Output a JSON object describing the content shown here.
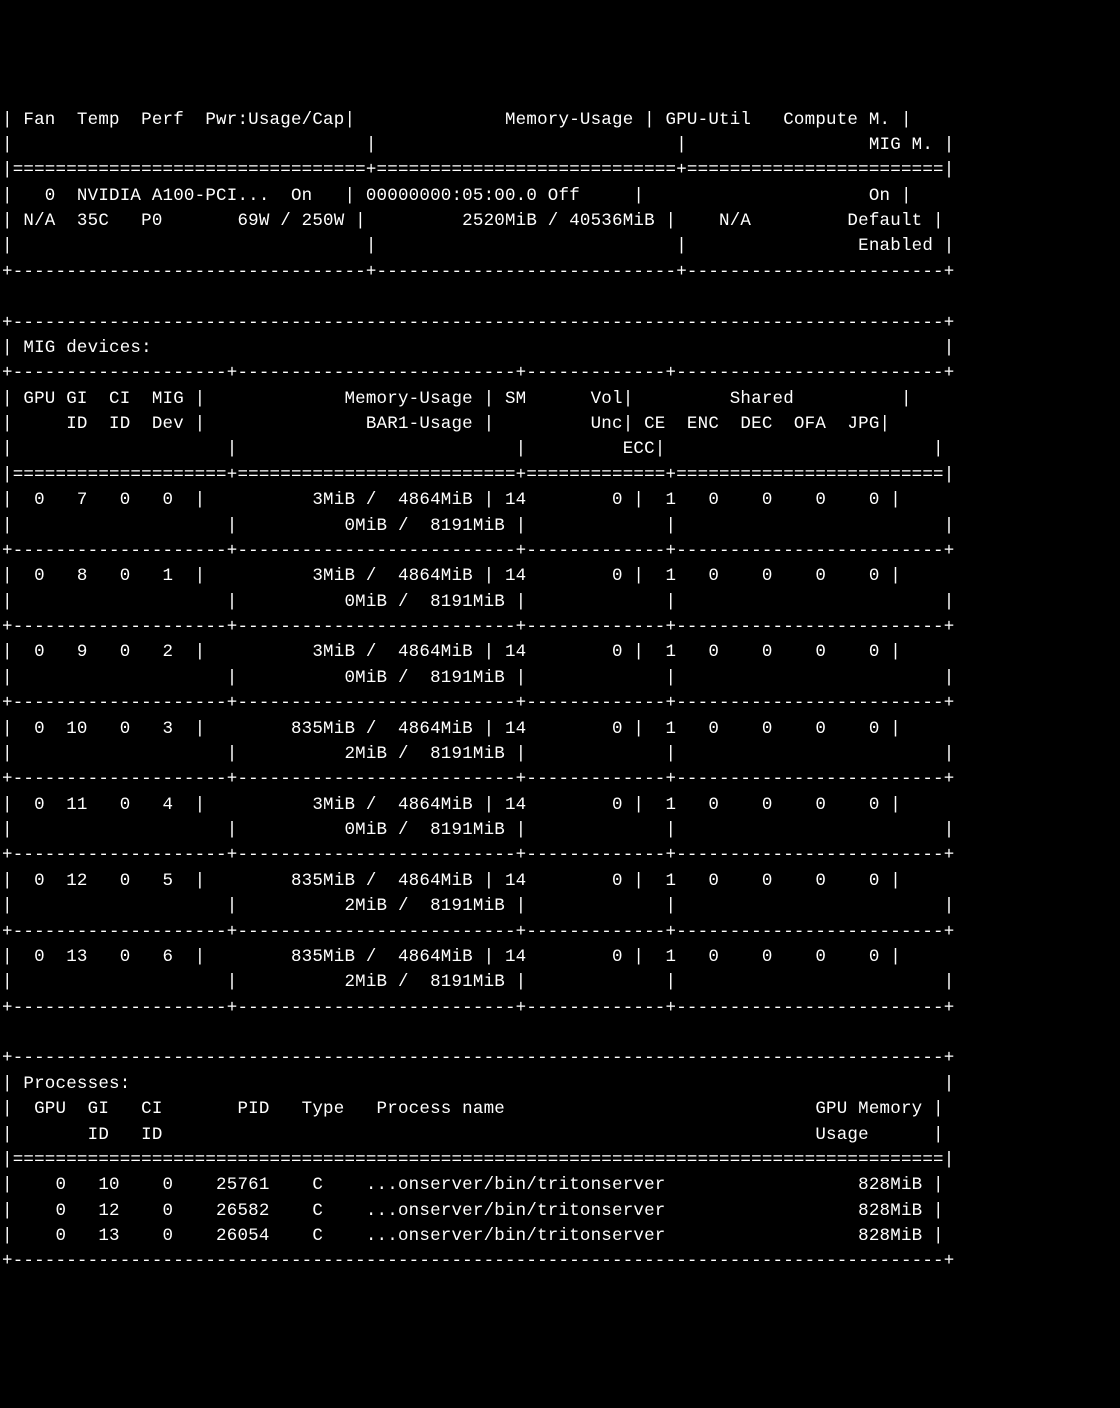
{
  "header": {
    "labels": {
      "fan": "Fan",
      "temp": "Temp",
      "perf": "Perf",
      "pwr": "Pwr:Usage/Cap",
      "mem": "Memory-Usage",
      "gpuutil": "GPU-Util",
      "compute": "Compute M.",
      "migm": "MIG M."
    }
  },
  "gpu": {
    "index": "0",
    "name": "NVIDIA A100-PCI...",
    "persistence": "On",
    "busid": "00000000:05:00.0",
    "disp_active": "Off",
    "ecc": "On",
    "fan": "N/A",
    "temp": "35C",
    "perf": "P0",
    "pwr_usage": "69W",
    "pwr_cap": "250W",
    "mem_used": "2520MiB",
    "mem_total": "40536MiB",
    "gpu_util": "N/A",
    "compute_mode": "Default",
    "mig_mode": "Enabled"
  },
  "mig": {
    "title": "MIG devices:",
    "header": {
      "gpu": "GPU",
      "gi": "GI",
      "ci": "CI",
      "migdev": "MIG",
      "id": "ID",
      "dev": "Dev",
      "mem": "Memory-Usage",
      "bar1": "BAR1-Usage",
      "sm": "SM",
      "vol": "Vol",
      "unc": "Unc",
      "ecc": "ECC",
      "shared": "Shared",
      "ce": "CE",
      "enc": "ENC",
      "dec": "DEC",
      "ofa": "OFA",
      "jpg": "JPG"
    },
    "devices": [
      {
        "gpu": "0",
        "gi": "7",
        "ci": "0",
        "dev": "0",
        "mem_used": "3MiB",
        "mem_total": "4864MiB",
        "bar1_used": "0MiB",
        "bar1_total": "8191MiB",
        "sm": "14",
        "ecc": "0",
        "ce": "1",
        "enc": "0",
        "dec": "0",
        "ofa": "0",
        "jpg": "0"
      },
      {
        "gpu": "0",
        "gi": "8",
        "ci": "0",
        "dev": "1",
        "mem_used": "3MiB",
        "mem_total": "4864MiB",
        "bar1_used": "0MiB",
        "bar1_total": "8191MiB",
        "sm": "14",
        "ecc": "0",
        "ce": "1",
        "enc": "0",
        "dec": "0",
        "ofa": "0",
        "jpg": "0"
      },
      {
        "gpu": "0",
        "gi": "9",
        "ci": "0",
        "dev": "2",
        "mem_used": "3MiB",
        "mem_total": "4864MiB",
        "bar1_used": "0MiB",
        "bar1_total": "8191MiB",
        "sm": "14",
        "ecc": "0",
        "ce": "1",
        "enc": "0",
        "dec": "0",
        "ofa": "0",
        "jpg": "0"
      },
      {
        "gpu": "0",
        "gi": "10",
        "ci": "0",
        "dev": "3",
        "mem_used": "835MiB",
        "mem_total": "4864MiB",
        "bar1_used": "2MiB",
        "bar1_total": "8191MiB",
        "sm": "14",
        "ecc": "0",
        "ce": "1",
        "enc": "0",
        "dec": "0",
        "ofa": "0",
        "jpg": "0"
      },
      {
        "gpu": "0",
        "gi": "11",
        "ci": "0",
        "dev": "4",
        "mem_used": "3MiB",
        "mem_total": "4864MiB",
        "bar1_used": "0MiB",
        "bar1_total": "8191MiB",
        "sm": "14",
        "ecc": "0",
        "ce": "1",
        "enc": "0",
        "dec": "0",
        "ofa": "0",
        "jpg": "0"
      },
      {
        "gpu": "0",
        "gi": "12",
        "ci": "0",
        "dev": "5",
        "mem_used": "835MiB",
        "mem_total": "4864MiB",
        "bar1_used": "2MiB",
        "bar1_total": "8191MiB",
        "sm": "14",
        "ecc": "0",
        "ce": "1",
        "enc": "0",
        "dec": "0",
        "ofa": "0",
        "jpg": "0"
      },
      {
        "gpu": "0",
        "gi": "13",
        "ci": "0",
        "dev": "6",
        "mem_used": "835MiB",
        "mem_total": "4864MiB",
        "bar1_used": "2MiB",
        "bar1_total": "8191MiB",
        "sm": "14",
        "ecc": "0",
        "ce": "1",
        "enc": "0",
        "dec": "0",
        "ofa": "0",
        "jpg": "0"
      }
    ]
  },
  "processes": {
    "title": "Processes:",
    "header": {
      "gpu": "GPU",
      "gi": "GI",
      "ci": "CI",
      "id": "ID",
      "pid": "PID",
      "type": "Type",
      "pname": "Process name",
      "gmem": "GPU Memory",
      "usage": "Usage"
    },
    "rows": [
      {
        "gpu": "0",
        "gi": "10",
        "ci": "0",
        "pid": "25761",
        "type": "C",
        "name": "...onserver/bin/tritonserver",
        "mem": "828MiB"
      },
      {
        "gpu": "0",
        "gi": "12",
        "ci": "0",
        "pid": "26582",
        "type": "C",
        "name": "...onserver/bin/tritonserver",
        "mem": "828MiB"
      },
      {
        "gpu": "0",
        "gi": "13",
        "ci": "0",
        "pid": "26054",
        "type": "C",
        "name": "...onserver/bin/tritonserver",
        "mem": "828MiB"
      }
    ]
  }
}
